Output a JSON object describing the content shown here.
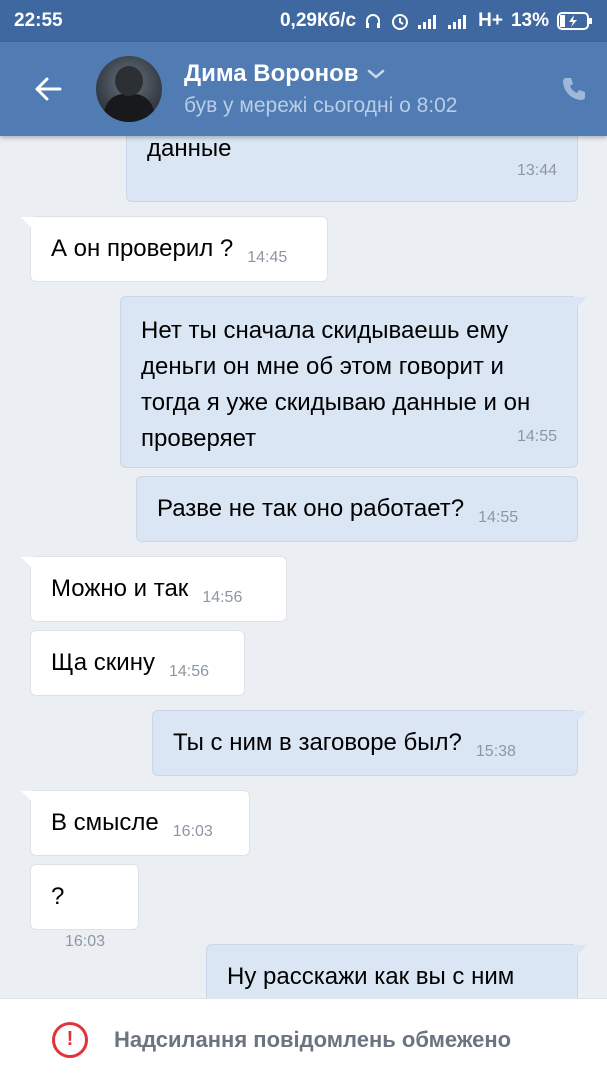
{
  "status_bar": {
    "time": "22:55",
    "network_speed": "0,29Кб/с",
    "network_type": "H+",
    "battery": "13%"
  },
  "header": {
    "contact_name": "Дима Воронов",
    "contact_status": "був у мережі сьогодні о 8:02"
  },
  "messages": [
    {
      "direction": "out",
      "text": "он мне об этом скажет и я скину данные",
      "time": "13:44"
    },
    {
      "direction": "in",
      "text": "А он проверил ?",
      "time": "14:45"
    },
    {
      "direction": "out",
      "text": "Нет ты сначала скидываешь ему деньги он мне об этом говорит и тогда я уже скидываю данные и он проверяет",
      "time": "14:55"
    },
    {
      "direction": "out",
      "text": "Разве не так оно работает?",
      "time": "14:55"
    },
    {
      "direction": "in",
      "text": "Можно и так",
      "time": "14:56"
    },
    {
      "direction": "in",
      "text": "Ща скину",
      "time": "14:56"
    },
    {
      "direction": "out",
      "text": "Ты с ним в заговоре был?",
      "time": "15:38"
    },
    {
      "direction": "in",
      "text": "В смысле",
      "time": "16:03"
    },
    {
      "direction": "in",
      "text": "?",
      "time": "16:03"
    },
    {
      "direction": "out",
      "text": "Ну расскажи как вы с ним",
      "time": ""
    }
  ],
  "footer": {
    "restricted_text": "Надсилання повідомлень обмежено"
  },
  "colors": {
    "status_bar": "#3f68a0",
    "app_bar": "#507cb3",
    "chat_background": "#ebeff4",
    "outgoing_bubble": "#dbe6f4",
    "incoming_bubble": "#ffffff",
    "warning": "#e0343a"
  }
}
